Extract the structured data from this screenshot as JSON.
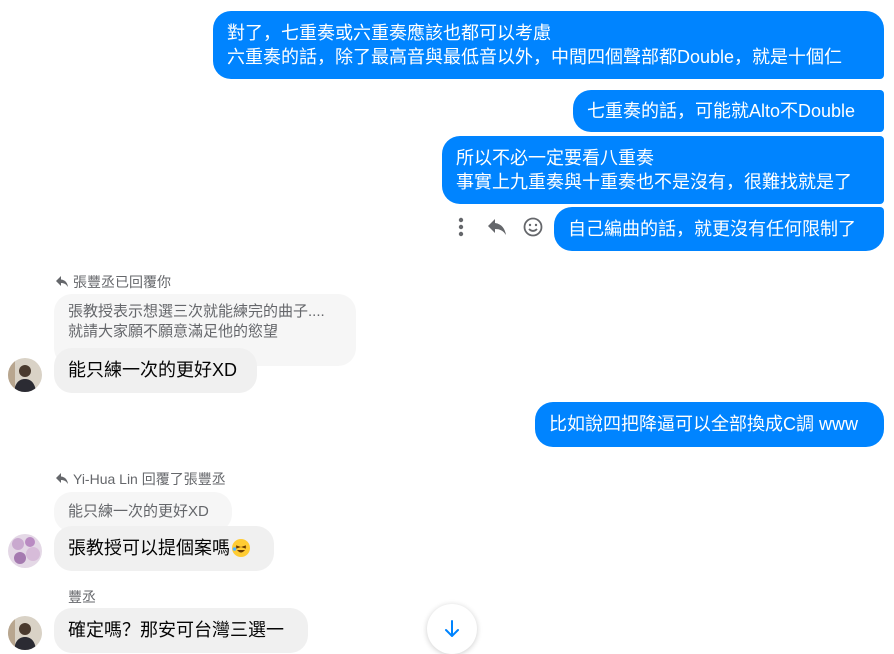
{
  "messages_out": {
    "m1_line1": "對了，七重奏或六重奏應該也都可以考慮",
    "m1_line2": "六重奏的話，除了最高音與最低音以外，中間四個聲部都Double，就是十個仁",
    "m2": "七重奏的話，可能就Alto不Double",
    "m3_line1": "所以不必一定要看八重奏",
    "m3_line2": "事實上九重奏與十重奏也不是沒有，很難找就是了",
    "m4": "自己編曲的話，就更沒有任何限制了",
    "m5": "比如說四把降逼可以全部換成C調 www"
  },
  "reply1": {
    "meta": "張豐丞已回覆你",
    "quote_line1": "張教授表示想選三次就能練完的曲子....",
    "quote_line2": "就請大家願不願意滿足他的慾望",
    "text": "能只練一次的更好XD"
  },
  "reply2": {
    "meta": "Yi-Hua Lin 回覆了張豐丞",
    "quote": "能只練一次的更好XD",
    "text": "張教授可以提個案嗎"
  },
  "message3": {
    "sender": "豐丞",
    "text": "確定嗎？那安可台灣三選一"
  },
  "icons": {
    "more": "more-vertical-icon",
    "reply": "reply-icon",
    "react": "smiley-icon",
    "scroll": "arrow-down-icon"
  },
  "colors": {
    "accent": "#0084ff",
    "incoming_bg": "#f0f0f0",
    "meta_text": "#65676b"
  }
}
